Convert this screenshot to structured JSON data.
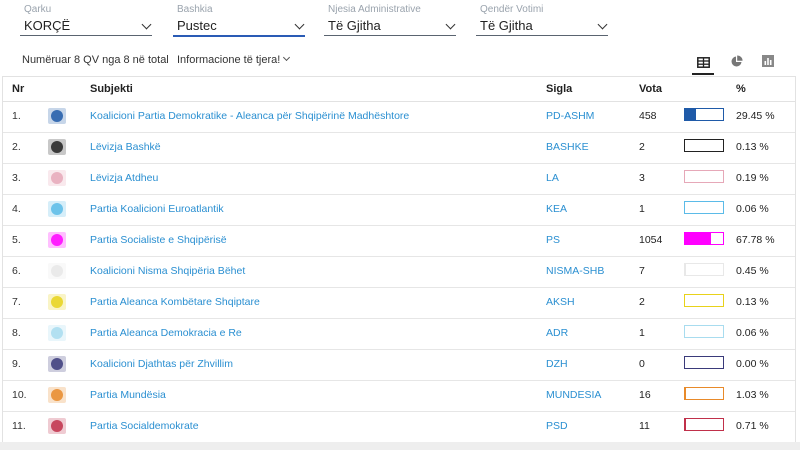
{
  "filters": [
    {
      "label": "Qarku",
      "value": "KORÇË"
    },
    {
      "label": "Bashkia",
      "value": "Pustec"
    },
    {
      "label": "Njesia Administrative",
      "value": "Të Gjitha"
    },
    {
      "label": "Qendër Votimi",
      "value": "Të Gjitha"
    }
  ],
  "info": {
    "count_text": "Numëruar 8 QV nga 8 në total",
    "more_info": "Informacione të tjera!"
  },
  "views": [
    {
      "icon": "table-icon",
      "active": true
    },
    {
      "icon": "pie-chart-icon",
      "active": false
    },
    {
      "icon": "bar-chart-icon",
      "active": false
    }
  ],
  "table": {
    "headers": {
      "nr": "Nr",
      "subjekti": "Subjekti",
      "sigla": "Sigla",
      "vota": "Vota",
      "pct": "%"
    },
    "rows": [
      {
        "nr": "1.",
        "subject": "Koalicioni Partia Demokratike - Aleanca për Shqipërinë Madhështore",
        "sigla": "PD-ASHM",
        "vota": "458",
        "pct": "29.45 %",
        "share": 0.2945,
        "color": "#1f5aa8",
        "logo": "pd-logo-icon"
      },
      {
        "nr": "2.",
        "subject": "Lëvizja Bashkë",
        "sigla": "BASHKE",
        "vota": "2",
        "pct": "0.13 %",
        "share": 0.0013,
        "color": "#222222",
        "logo": "bashke-logo-icon"
      },
      {
        "nr": "3.",
        "subject": "Lëvizja Atdheu",
        "sigla": "LA",
        "vota": "3",
        "pct": "0.19 %",
        "share": 0.0019,
        "color": "#e6a8b8",
        "logo": "la-logo-icon"
      },
      {
        "nr": "4.",
        "subject": "Partia Koalicioni Euroatlantik",
        "sigla": "KEA",
        "vota": "1",
        "pct": "0.06 %",
        "share": 0.0006,
        "color": "#5bbbe8",
        "logo": "kea-logo-icon"
      },
      {
        "nr": "5.",
        "subject": "Partia Socialiste e Shqipërisë",
        "sigla": "PS",
        "vota": "1054",
        "pct": "67.78 %",
        "share": 0.6778,
        "color": "#ff00ff",
        "logo": "ps-logo-icon"
      },
      {
        "nr": "6.",
        "subject": "Koalicioni Nisma Shqipëria Bëhet",
        "sigla": "NISMA-SHB",
        "vota": "7",
        "pct": "0.45 %",
        "share": 0.0045,
        "color": "#e8e8e8",
        "logo": "nisma-logo-icon"
      },
      {
        "nr": "7.",
        "subject": "Partia Aleanca Kombëtare Shqiptare",
        "sigla": "AKSH",
        "vota": "2",
        "pct": "0.13 %",
        "share": 0.0013,
        "color": "#e8d21a",
        "logo": "aksh-logo-icon"
      },
      {
        "nr": "8.",
        "subject": "Partia Aleanca Demokracia e Re",
        "sigla": "ADR",
        "vota": "1",
        "pct": "0.06 %",
        "share": 0.0006,
        "color": "#a8dcef",
        "logo": "adr-logo-icon"
      },
      {
        "nr": "9.",
        "subject": "Koalicioni Djathtas për Zhvillim",
        "sigla": "DZH",
        "vota": "0",
        "pct": "0.00 %",
        "share": 0,
        "color": "#3a3a7a",
        "logo": "dzh-logo-icon"
      },
      {
        "nr": "10.",
        "subject": "Partia Mundësia",
        "sigla": "MUNDESIA",
        "vota": "16",
        "pct": "1.03 %",
        "share": 0.0103,
        "color": "#e88a2a",
        "logo": "mundesia-logo-icon"
      },
      {
        "nr": "11.",
        "subject": "Partia Socialdemokrate",
        "sigla": "PSD",
        "vota": "11",
        "pct": "0.71 %",
        "share": 0.0071,
        "color": "#c0304a",
        "logo": "psd-logo-icon"
      }
    ]
  }
}
